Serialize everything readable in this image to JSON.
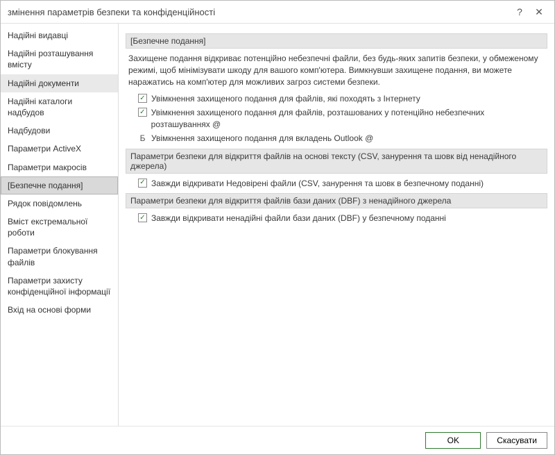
{
  "window": {
    "title": "змінення параметрів безпеки та конфіденційності"
  },
  "sidebar": {
    "items": [
      {
        "label": "Надійні видавці",
        "selected": false
      },
      {
        "label": "Надійні розташування вмісту",
        "selected": false
      },
      {
        "label": "Надійні документи",
        "selected": false,
        "highlight": true
      },
      {
        "label": "Надійні каталоги надбудов",
        "selected": false
      },
      {
        "label": "Надбудови",
        "selected": false
      },
      {
        "label": "Параметри ActiveX",
        "selected": false
      },
      {
        "label": "Параметри макросів",
        "selected": false
      },
      {
        "label": "[Безпечне подання]",
        "selected": true
      },
      {
        "label": "Рядок повідомлень",
        "selected": false
      },
      {
        "label": "Вміст екстремальної роботи",
        "selected": false
      },
      {
        "label": "Параметри блокування файлів",
        "selected": false
      },
      {
        "label": "Параметри захисту конфіденційної інформації",
        "selected": false
      },
      {
        "label": "Вхід на основі форми",
        "selected": false
      }
    ]
  },
  "main": {
    "section1": {
      "title": "[Безпечне подання]",
      "description": "Захищене подання відкриває потенційно небезпечні файли, без будь-яких запитів безпеки, у обмеженому режимі, щоб мінімізувати шкоду для вашого комп'ютера. Вимкнувши захищене подання, ви можете наражатись на комп'ютер для можливих загроз системи безпеки.",
      "opts": [
        {
          "checked": true,
          "label": "Увімкнення захищеного подання для файлів, які походять з Інтернету"
        },
        {
          "checked": true,
          "label": "Увімкнення захищеного подання для файлів, розташованих у потенційно небезпечних розташуваннях @"
        },
        {
          "letter": "Б",
          "label": "Увімкнення захищеного подання для вкладень Outlook @"
        }
      ]
    },
    "section2": {
      "title": "Параметри безпеки для відкриття файлів на основі тексту (CSV, занурення та шовк від ненадійного джерела)",
      "opts": [
        {
          "checked": true,
          "label": "Завжди відкривати Недовірені файли (CSV, занурення та шовк в безпечному поданні)"
        }
      ]
    },
    "section3": {
      "title": "Параметри безпеки для відкриття файлів бази даних (DBF) з ненадійного джерела",
      "opts": [
        {
          "checked": true,
          "label": "Завжди відкривати ненадійні файли бази даних (DBF) у безпечному поданні"
        }
      ]
    }
  },
  "footer": {
    "ok": "OK",
    "cancel": "Скасувати"
  },
  "icons": {
    "help": "?",
    "close": "✕",
    "check": "✓"
  }
}
